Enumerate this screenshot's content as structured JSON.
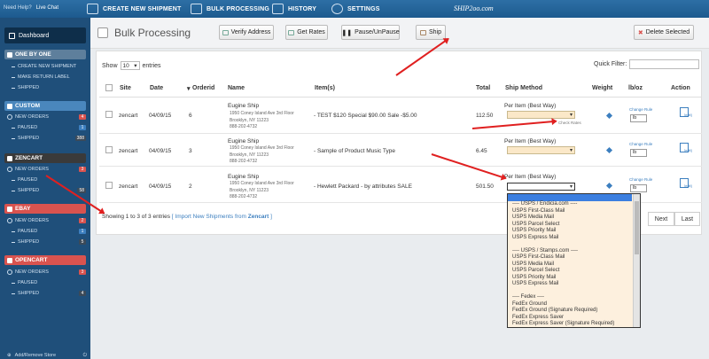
{
  "topbar": {
    "help": "Need Help?",
    "live_chat": "Live Chat",
    "nav": [
      "CREATE NEW SHIPMENT",
      "BULK PROCESSING",
      "HISTORY",
      "SETTINGS"
    ],
    "brand": "SHIP2oo.com"
  },
  "sidebar": {
    "dashboard": "Dashboard",
    "sections": [
      {
        "label": "ONE BY ONE",
        "items": [
          {
            "label": "CREATE NEW SHIPMENT"
          },
          {
            "label": "MAKE RETURN LABEL"
          },
          {
            "label": "SHIPPED"
          }
        ]
      },
      {
        "label": "CUSTOM",
        "items": [
          {
            "label": "NEW ORDERS",
            "count": "4"
          },
          {
            "label": "PAUSED",
            "count": "1"
          },
          {
            "label": "SHIPPED",
            "count": "388"
          }
        ]
      },
      {
        "label": "ZENCART",
        "items": [
          {
            "label": "NEW ORDERS",
            "count": "3"
          },
          {
            "label": "PAUSED"
          },
          {
            "label": "SHIPPED",
            "count": "58"
          }
        ]
      },
      {
        "label": "EBAY",
        "items": [
          {
            "label": "NEW ORDERS",
            "count": "2"
          },
          {
            "label": "PAUSED",
            "count": "1"
          },
          {
            "label": "SHIPPED",
            "count": "5"
          }
        ]
      },
      {
        "label": "OPENCART",
        "items": [
          {
            "label": "NEW ORDERS",
            "count": "3"
          },
          {
            "label": "PAUSED"
          },
          {
            "label": "SHIPPED",
            "count": "4"
          }
        ]
      }
    ],
    "footer_add": "Add/Remove Store"
  },
  "header": {
    "title": "Bulk Processing",
    "buttons": {
      "verify": "Verify Address",
      "rates": "Get Rates",
      "pause": "Pause/UnPause",
      "ship": "Ship",
      "delete": "Delete Selected"
    }
  },
  "table": {
    "show": "Show",
    "entries_value": "10",
    "entries": "entries",
    "quick_filter": "Quick Filter:",
    "columns": [
      "Site",
      "Date",
      "Orderid",
      "Name",
      "Item(s)",
      "Total",
      "Ship Method",
      "Weight",
      "lb/oz",
      "Action"
    ],
    "rows": [
      {
        "site": "zencart",
        "date": "04/09/15",
        "orderid": "6",
        "name": "Eugine Ship",
        "addr1": "1950 Coney Island Ave 3rd Floor",
        "addr2": "Brooklyn, NY 11223",
        "addr3": "888-202-4732",
        "item": "- TEST $120 Special $90.00 Sale -$5.00",
        "total": "112.50",
        "method": "Per Item (Best Way)",
        "check_rates": "Check Rates",
        "change_rule": "Change Rule",
        "unit": "lb",
        "action": "[edit]"
      },
      {
        "site": "zencart",
        "date": "04/09/15",
        "orderid": "3",
        "name": "Eugine Ship",
        "addr1": "1950 Coney Island Ave 3rd Floor",
        "addr2": "Brooklyn, NY 11223",
        "addr3": "888-202-4732",
        "item": "- Sample of Product Music Type",
        "total": "6.45",
        "method": "Per Item (Best Way)",
        "change_rule": "Change Rule",
        "unit": "lb",
        "action": "[edit]"
      },
      {
        "site": "zencart",
        "date": "04/09/15",
        "orderid": "2",
        "name": "Eugine Ship",
        "addr1": "1950 Coney Island Ave 3rd Floor",
        "addr2": "Brooklyn, NY 11223",
        "addr3": "888-202-4732",
        "item": "- Hewlett Packard - by attributes SALE",
        "total": "501.50",
        "method": "Per Item (Best Way)",
        "change_rule": "Change Rule",
        "unit": "lb",
        "action": "[edit]"
      }
    ],
    "showing": "Showing 1 to 3 of 3 entries",
    "import_link": "[ Import New Shipments from",
    "import_store": "Zencart",
    "import_end": "]",
    "pager": {
      "next": "Next",
      "last": "Last"
    }
  },
  "dropdown": {
    "options": [
      "---- USPS / Endicia.com ----",
      "USPS First-Class Mail",
      "USPS Media Mail",
      "USPS Parcel Select",
      "USPS Priority Mail",
      "USPS Express Mail",
      "",
      "---- USPS / Stamps.com ----",
      "USPS First-Class Mail",
      "USPS Media Mail",
      "USPS Parcel Select",
      "USPS Priority Mail",
      "USPS Express Mail",
      "",
      "---- Fedex ----",
      "FedEx Ground",
      "FedEx Ground (Signature Required)",
      "FedEx Express Saver",
      "FedEx Express Saver (Signature Required)"
    ]
  },
  "colors": {
    "topbar": "#1d5a8e",
    "sidebar": "#1f4f7a",
    "accent": "#3c7fbf",
    "badge": "#d9534f",
    "annotation": "#e02020"
  }
}
